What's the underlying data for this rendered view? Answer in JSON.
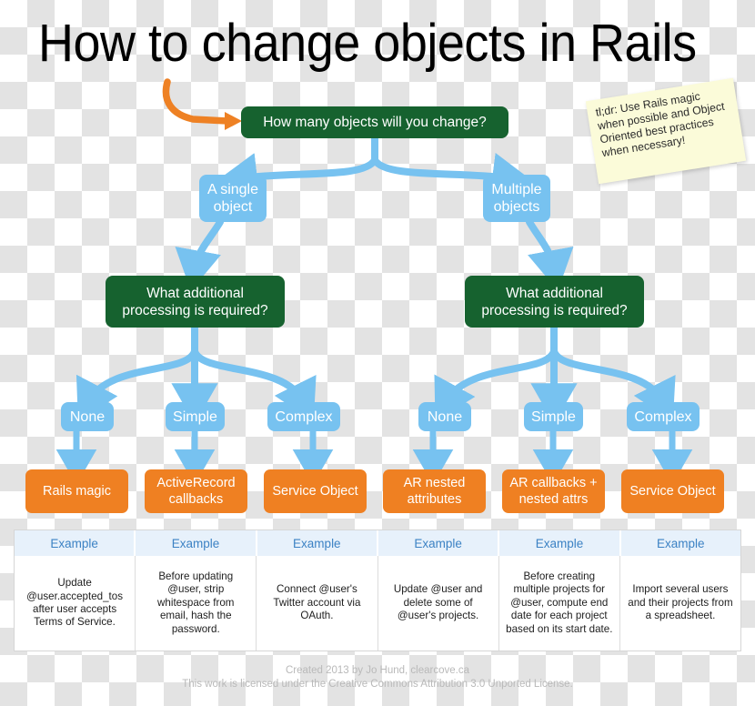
{
  "title": "How to change objects in Rails",
  "colors": {
    "green": "#16622f",
    "blue": "#77c2f0",
    "orange": "#ef8022",
    "sticky": "#fbfbd9",
    "arrow_orange": "#ee8124",
    "table_header_bg": "#e7f1fb",
    "table_header_text": "#3c82c4",
    "footer_text": "#b9b9b9"
  },
  "sticky_note": {
    "text": "tl;dr: Use Rails magic when possible and Object Oriented best practices when necessary!"
  },
  "root": {
    "label": "How many objects will you change?"
  },
  "branches": [
    {
      "label": "A single object"
    },
    {
      "label": "Multiple objects"
    }
  ],
  "decisions": [
    {
      "label": "What additional processing is required?"
    },
    {
      "label": "What additional processing is required?"
    }
  ],
  "levels": [
    {
      "label": "None"
    },
    {
      "label": "Simple"
    },
    {
      "label": "Complex"
    },
    {
      "label": "None"
    },
    {
      "label": "Simple"
    },
    {
      "label": "Complex"
    }
  ],
  "outcomes": [
    {
      "label": "Rails magic"
    },
    {
      "label": "ActiveRecord callbacks"
    },
    {
      "label": "Service Object"
    },
    {
      "label": "AR nested attributes"
    },
    {
      "label": "AR callbacks + nested attrs"
    },
    {
      "label": "Service Object"
    }
  ],
  "table": {
    "headers": [
      "Example",
      "Example",
      "Example",
      "Example",
      "Example",
      "Example"
    ],
    "cells": [
      "Update @user.accepted_tos after user accepts Terms of Service.",
      "Before updating @user, strip whitespace from email, hash the password.",
      "Connect @user's Twitter account via OAuth.",
      "Update @user and delete some of @user's projects.",
      "Before creating multiple projects for @user, compute end date for each project based on its start date.",
      "Import several users and their projects from a spreadsheet."
    ]
  },
  "footer": {
    "line1": "Created 2013 by Jo Hund, clearcove.ca",
    "line2": "This work is licensed under the Creative Commons Attribution 3.0 Unported License."
  }
}
